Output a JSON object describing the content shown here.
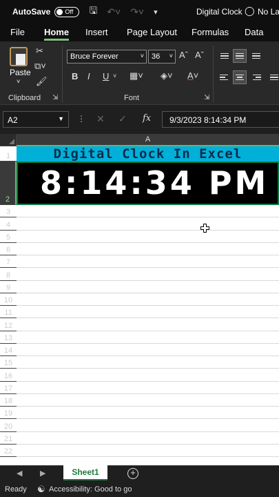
{
  "titlebar": {
    "autosave_label": "AutoSave",
    "autosave_state": "Off",
    "doc_title": "Digital Clock",
    "sensitivity": "No La"
  },
  "ribbon_tabs": [
    "File",
    "Home",
    "Insert",
    "Page Layout",
    "Formulas",
    "Data"
  ],
  "active_tab": "Home",
  "clipboard": {
    "paste_label": "Paste",
    "group_label": "Clipboard"
  },
  "font": {
    "name": "Bruce Forever",
    "size": "36",
    "group_label": "Font",
    "bold": "B",
    "italic": "I",
    "underline": "U"
  },
  "formula_bar": {
    "name_box": "A2",
    "fx": "fx",
    "value": "9/3/2023  8:14:34 PM"
  },
  "sheet": {
    "column_header": "A",
    "row_numbers": [
      "1",
      "2",
      "3",
      "4",
      "5",
      "6",
      "7",
      "8",
      "9",
      "10",
      "11",
      "12",
      "13",
      "14",
      "15",
      "16",
      "17",
      "18",
      "19",
      "20",
      "21",
      "22"
    ],
    "a1": "Digital Clock In Excel",
    "a2": "8:14:34 PM",
    "title_fill": "#00b0d8",
    "clock_fill": "#000000"
  },
  "sheet_tabs": {
    "active": "Sheet1"
  },
  "status": {
    "ready": "Ready",
    "accessibility": "Accessibility: Good to go"
  }
}
